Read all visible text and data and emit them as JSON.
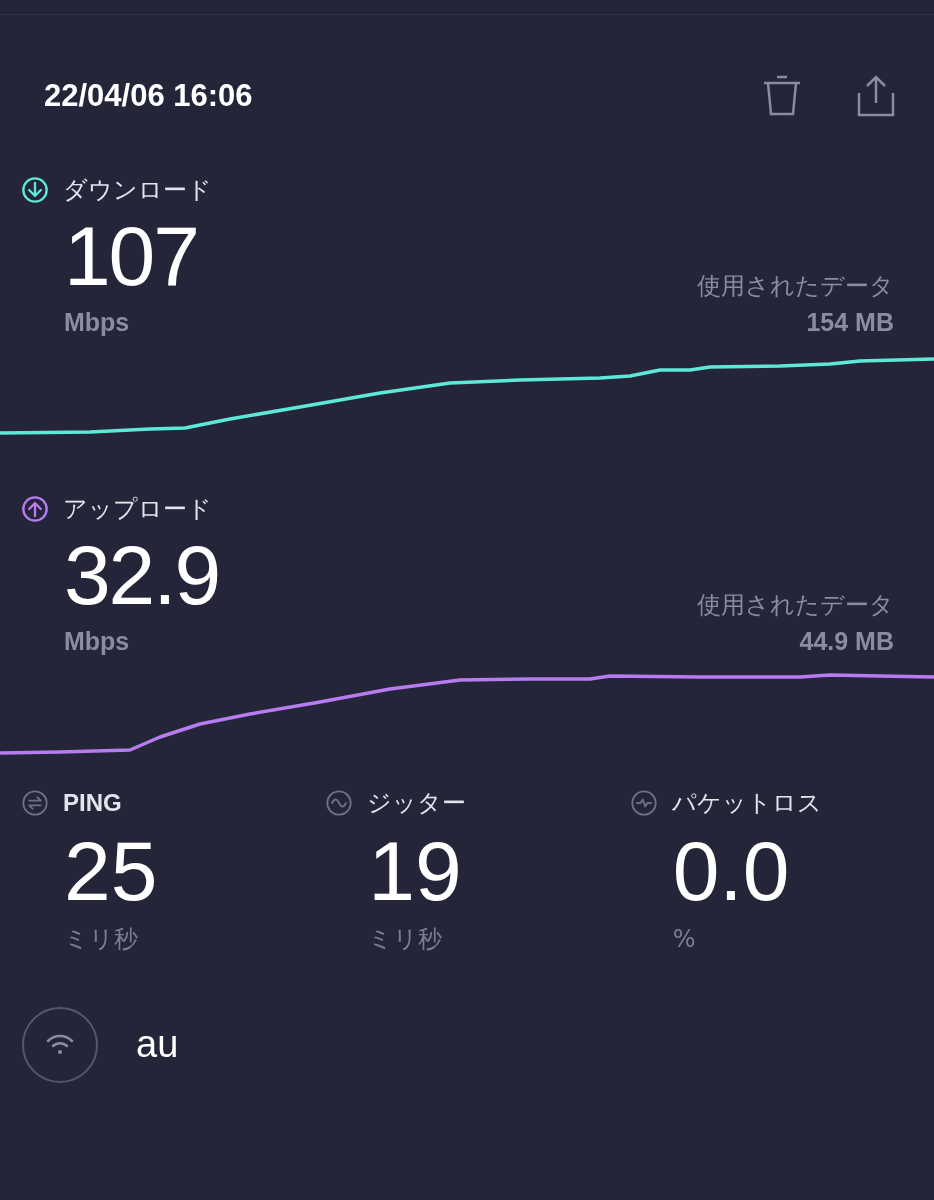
{
  "header": {
    "datetime": "22/04/06 16:06"
  },
  "sections": [
    {
      "kind": "download",
      "label": "ダウンロード",
      "value": "107",
      "unit": "Mbps",
      "data_label": "使用されたデータ",
      "data_value": "154 MB",
      "color": "#5ee8d8"
    },
    {
      "kind": "upload",
      "label": "アップロード",
      "value": "32.9",
      "unit": "Mbps",
      "data_label": "使用されたデータ",
      "data_value": "44.9 MB",
      "color": "#b67cf0"
    }
  ],
  "stats": [
    {
      "kind": "ping",
      "label": "PING",
      "value": "25",
      "unit": "ミリ秒"
    },
    {
      "kind": "jitter",
      "label": "ジッター",
      "value": "19",
      "unit": "ミリ秒"
    },
    {
      "kind": "loss",
      "label": "パケットロス",
      "value": "0.0",
      "unit": "%"
    }
  ],
  "network": {
    "name": "au"
  }
}
